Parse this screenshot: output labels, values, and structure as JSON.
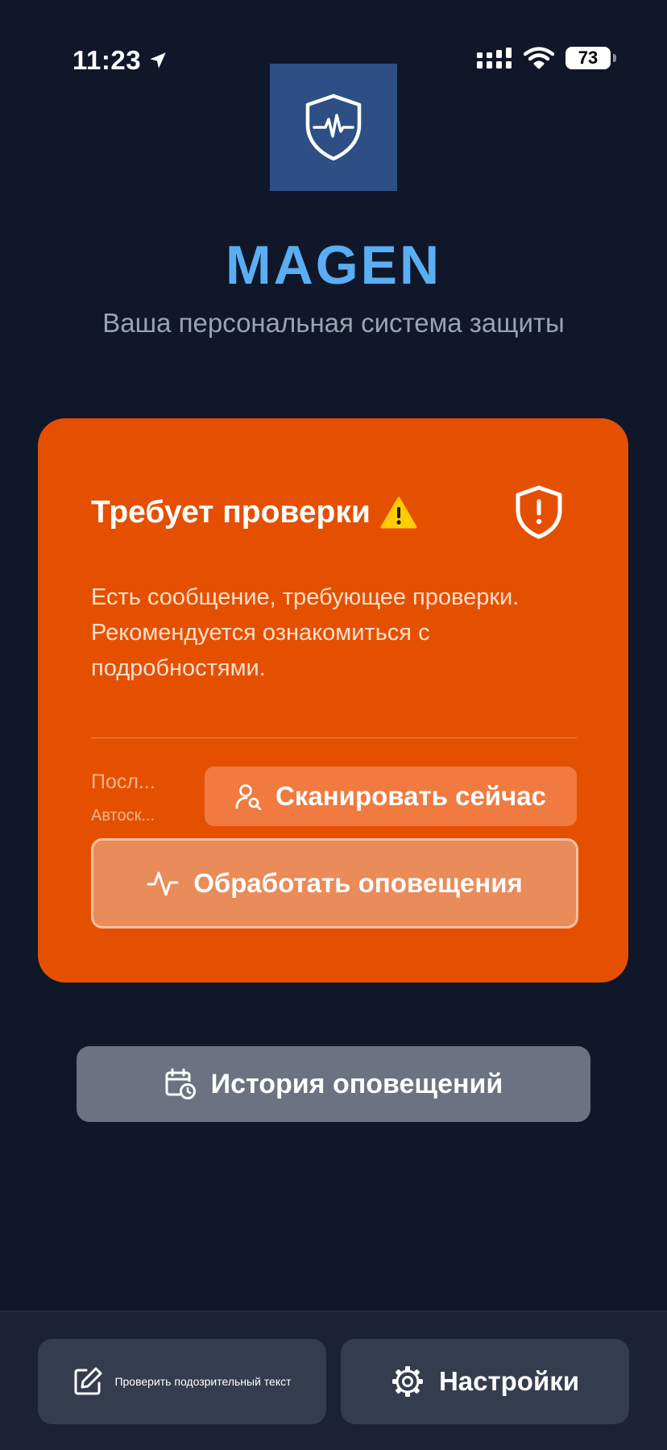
{
  "status_bar": {
    "time": "11:23",
    "battery": "73",
    "icons": [
      "location-arrow-icon",
      "cellular-signal-icon",
      "wifi-icon",
      "battery-icon"
    ]
  },
  "app": {
    "logo_icon": "shield-heartbeat-icon",
    "title": "MAGEN",
    "subtitle": "Ваша персональная система защиты"
  },
  "alert_card": {
    "color": "#e55000",
    "heading": "Требует проверки",
    "heading_emoji": "⚠️",
    "shield_icon": "shield-exclamation-icon",
    "message": "Есть сообщение, требующее проверки. Рекомендуется ознакомиться с подробностями.",
    "last_scan_label": "Посл...",
    "auto_scan_label": "Автоск...",
    "scan_button_label": "Сканировать сейчас",
    "scan_button_icon": "user-search-icon",
    "process_button_label": "Обработать оповещения",
    "process_button_icon": "activity-pulse-icon"
  },
  "history_button": {
    "label": "История оповещений",
    "icon": "calendar-clock-icon"
  },
  "bottom_bar": {
    "check_text_label": "Проверить подозрительный текст",
    "check_text_icon": "edit-icon",
    "settings_label": "Настройки",
    "settings_icon": "gear-icon"
  },
  "colors": {
    "background": "#0f1729",
    "title_accent": "#5aaef4",
    "logo_bg": "#2d4f86",
    "history_button": "#6b7281",
    "bottom_button": "#343d4d"
  }
}
